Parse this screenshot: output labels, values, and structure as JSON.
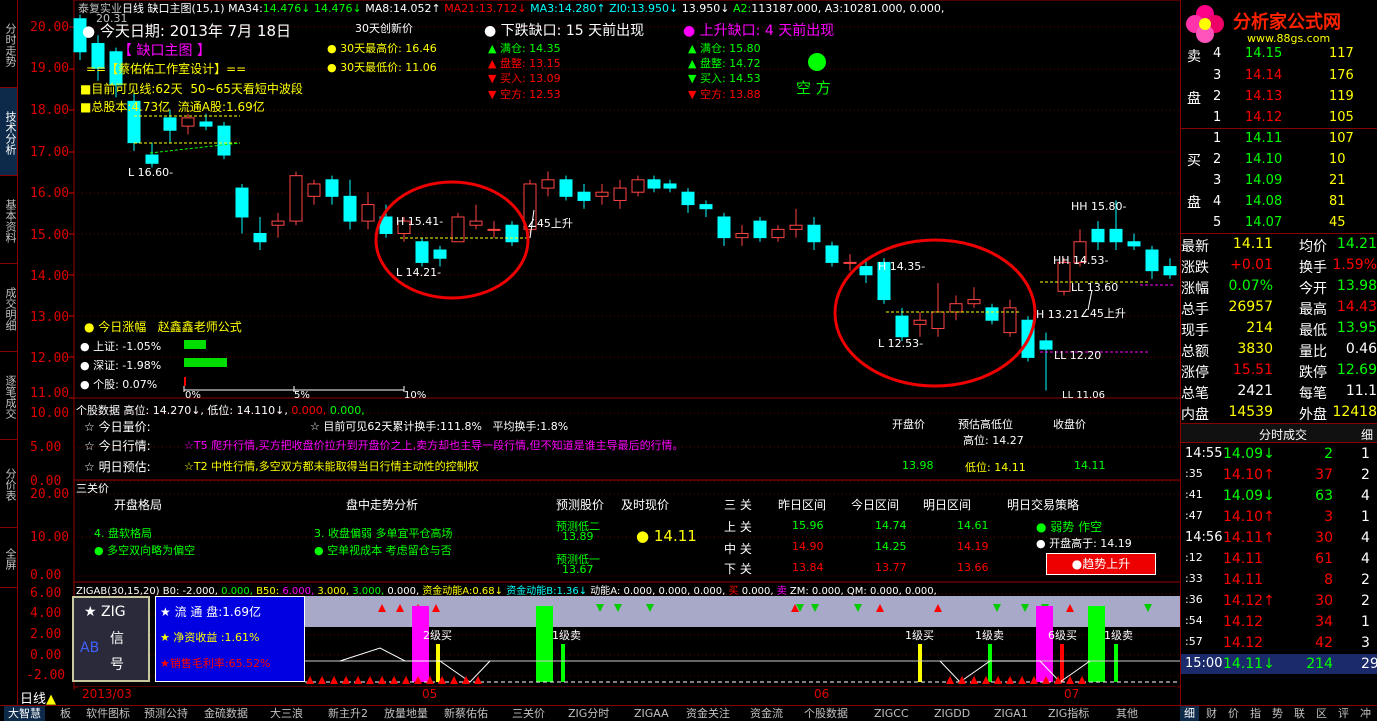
{
  "header": {
    "stock": "泰复实业",
    "period": "日线",
    "title": "缺口主图",
    "params": "(15,1)",
    "ma34_lbl": "MA34:",
    "ma34": "14.476↓",
    "ma34b": "14.476↓",
    "ma8_lbl": "MA8:",
    "ma8": "14.052↑",
    "ma21_lbl": "MA21:",
    "ma21": "13.712↓",
    "ma3_lbl": "MA3:",
    "ma3": "14.280↑",
    "zi0_lbl": "ZI0:",
    "zi0": "13.950↓",
    "zi0b": "13.950↓",
    "a2_lbl": "A2:",
    "a2": "113187.000,",
    "a3_lbl": "A3:",
    "a3": "10281.000,",
    "tail": "0.000,",
    "n1": "0.000",
    "logo_num": "20.31"
  },
  "mainchart": {
    "date_label": "今天日期:",
    "date": "2013年 7月 18日",
    "main_badge": "【 缺口主图 】",
    "designer": "==【蔡佑佑工作室设计】==",
    "visible_line": "目前可见线:62天",
    "wave": "50~65天看短中波段",
    "total_shares": "总股本:4.73亿",
    "float_shares": "流通A股:1.69亿",
    "new30": "30天创新价",
    "hi30": "30天最高价: 16.46",
    "lo30": "30天最低价: 11.06",
    "gap_down": "下跌缺口: 15 天前出现",
    "gap_up": "上升缺口: 4 天前出现",
    "dn_full": "满仓: 14.35",
    "dn_hold": "盘整: 13.15",
    "dn_buy": "买入: 13.09",
    "dn_short": "空方: 12.53",
    "up_full": "满仓: 15.80",
    "up_hold": "盘整: 14.72",
    "up_buy": "买入: 14.53",
    "up_short": "空方: 13.88",
    "side": "空 方",
    "today_rise": "今日涨幅",
    "teacher": "赵鑫鑫老师公式",
    "sh": "上证: -1.05%",
    "sz": "深证: -1.98%",
    "stock_pct": "个股: 0.07%",
    "scale0": "0%",
    "scale5": "5%",
    "scale10": "10%",
    "ann_l1660": "L 16.60-",
    "ann_h1541": "H 15.41-",
    "ann_l1421": "L 14.21-",
    "ann_up45a": "∠45上升",
    "ann_h1435": "H 14.35-",
    "ann_l1253": "L 12.53-",
    "ann_hh1580": "HH 15.80-",
    "ann_hh1453": "HH 14.53-",
    "ann_ll1360": "LL 13.60",
    "ann_h1321": "H 13.21",
    "ann_up45b": "∠45上升",
    "ann_ll1220": "LL 12.20",
    "ann_ll1106": "LL 11.06"
  },
  "yaxis": [
    "20.00",
    "19.00",
    "18.00",
    "17.00",
    "16.00",
    "15.00",
    "14.00",
    "13.00",
    "12.00",
    "11.00"
  ],
  "panel2": {
    "yaxis": [
      "10.00",
      "5.00",
      "0.00"
    ],
    "title": "个股数据",
    "hi": "高位: 14.270↓,",
    "lo": "低位: 14.110↓,",
    "z1": "0.000,",
    "z2": "0.000,",
    "today_qty": "今日量价:",
    "visible_turn": "目前可见62天累计换手:111.8%",
    "avg_turn": "平均换手:1.8%",
    "open_price": "开盘价",
    "est": "预估高低位",
    "close_price": "收盘价",
    "today_state": "今日行情:",
    "t5": "☆T5 爬升行情,买方把收盘价拉升到开盘价之上,卖方却也主导一段行情,但不知道是谁主导最后的行情。",
    "hi_pos": "高位: 14.27",
    "tomorrow": "明日预估:",
    "t2": "☆T2 中性行情,多空双方都未能取得当日行情主动性的控制权",
    "open_val": "13.98",
    "lo_pos": "低位: 14.11",
    "close_val": "14.11"
  },
  "panel3": {
    "yaxis": [
      "20.00",
      "10.00",
      "0.00"
    ],
    "title": "三关价",
    "open_pattern": "开盘格局",
    "intraday": "盘中走势分析",
    "pred": "预测股价",
    "now": "及时现价",
    "three": "三 关",
    "yday": "昨日区间",
    "today_r": "今日区间",
    "tomorrow_r": "明日区间",
    "strategy": "明日交易策略",
    "soft": "4. 盘软格局",
    "bias": "多空双向略为偏空",
    "close_weak": "3. 收盘偏弱 多单宜平仓高场",
    "short_see": "空单视成本 考虑留仓与否",
    "pred2": "预测低二",
    "pred2v": "13.89",
    "pred1": "预测低一",
    "pred1v": "13.67",
    "now_v": "14.11",
    "up": "上 关",
    "mid": "中 关",
    "down": "下 关",
    "up_y": "15.96",
    "up_t": "14.74",
    "up_n": "14.61",
    "mid_y": "14.90",
    "mid_t": "14.25",
    "mid_n": "14.19",
    "dn_y": "13.84",
    "dn_t": "13.77",
    "dn_n": "13.66",
    "weak": "弱势 作空",
    "open_hi": "开盘高于: 14.19",
    "trend": "●趋势上升"
  },
  "panel4": {
    "yaxis": [
      "6.00",
      "4.00",
      "2.00",
      "0.00",
      "-2.00"
    ],
    "header": "ZIGAB(30,15,20)",
    "b0": "B0: -2.000,",
    "h0": "0.000,",
    "b50": "B50:",
    "b50v": "6.000,",
    "h2": "3.000,",
    "h3": "3.000,",
    "h4": "0.000,",
    "zj": "资金动能A:",
    "zjv": "0.68↓",
    "zjb": "资金动能B:",
    "zjbv": "1.36↓",
    "dn": "动能A: 0.000,",
    "t1": "0.000,",
    "t2": "0.000,",
    "buy": "买",
    "sell": "卖",
    "t3": "0.000,",
    "zm": "ZM: 0.000,",
    "qm": "QM: 0.000,",
    "t4": "0.000,",
    "zig_title": "★ ZIG",
    "zig_sig": "信",
    "zig_num": "号",
    "ab": "AB",
    "float": "★ 流 通 盘:1.69亿",
    "net": "★ 净资收益 :1.61%",
    "margin": "★销售毛利率:65.52%",
    "buy2": "2级买",
    "sell1a": "1级卖",
    "buy1": "1级买",
    "sell1b": "1级卖",
    "buy6": "6级买",
    "sell1c": "1级卖",
    "date03": "2013/03",
    "date05": "05",
    "date06": "06",
    "date07": "07"
  },
  "lefttabs": [
    "分时走势",
    "技术分析",
    "基本资料",
    "成交明细",
    "逐笔成交",
    "分价表",
    "全屏"
  ],
  "orderbook": {
    "ask_label": "卖",
    "ask_label2": "盘",
    "bid_label": "买",
    "bid_label2": "盘",
    "asks": [
      {
        "n": "3",
        "p": "14.14",
        "v": "176"
      },
      {
        "n": "2",
        "p": "14.13",
        "v": "119"
      },
      {
        "n": "1",
        "p": "14.12",
        "v": "105"
      }
    ],
    "ask_top": {
      "n": "4",
      "p": "14.15",
      "v": "117"
    },
    "bids": [
      {
        "n": "1",
        "p": "14.11",
        "v": "107"
      },
      {
        "n": "2",
        "p": "14.10",
        "v": "10"
      },
      {
        "n": "3",
        "p": "14.09",
        "v": "21"
      },
      {
        "n": "4",
        "p": "14.08",
        "v": "81"
      },
      {
        "n": "5",
        "p": "14.07",
        "v": "45"
      }
    ]
  },
  "stats": [
    {
      "l": "最新",
      "v": "14.11",
      "l2": "均价",
      "v2": "14.21"
    },
    {
      "l": "涨跌",
      "v": "+0.01",
      "l2": "换手",
      "v2": "1.59%"
    },
    {
      "l": "涨幅",
      "v": "0.07%",
      "l2": "今开",
      "v2": "13.98"
    },
    {
      "l": "总手",
      "v": "26957",
      "l2": "最高",
      "v2": "14.43"
    },
    {
      "l": "现手",
      "v": "214",
      "l2": "最低",
      "v2": "13.95"
    },
    {
      "l": "总额",
      "v": "3830",
      "l2": "量比",
      "v2": "0.46"
    },
    {
      "l": "涨停",
      "v": "15.51",
      "l2": "跌停",
      "v2": "12.69"
    },
    {
      "l": "总笔",
      "v": "2421",
      "l2": "每笔",
      "v2": "11.1"
    },
    {
      "l": "内盘",
      "v": "14539",
      "l2": "外盘",
      "v2": "12418"
    }
  ],
  "ticks_title": "分时成交",
  "ticks_tab": "细",
  "ticks": [
    {
      "t": "14:55",
      "p": "14.09↓",
      "v": "2",
      "n": "1"
    },
    {
      "t": ":35",
      "p": "14.10↑",
      "v": "37",
      "n": "2"
    },
    {
      "t": ":41",
      "p": "14.09↓",
      "v": "63",
      "n": "4"
    },
    {
      "t": ":47",
      "p": "14.10↑",
      "v": "3",
      "n": "1"
    },
    {
      "t": "14:56",
      "p": "14.11↑",
      "v": "30",
      "n": "4"
    },
    {
      "t": ":12",
      "p": "14.11",
      "v": "61",
      "n": "4"
    },
    {
      "t": ":33",
      "p": "14.11",
      "v": "8",
      "n": "2"
    },
    {
      "t": ":36",
      "p": "14.12↑",
      "v": "30",
      "n": "2"
    },
    {
      "t": ":54",
      "p": "14.12",
      "v": "34",
      "n": "1"
    },
    {
      "t": ":57",
      "p": "14.12",
      "v": "42",
      "n": "3"
    },
    {
      "t": "15:00",
      "p": "14.11↓",
      "v": "214",
      "n": "29"
    }
  ],
  "bottom": {
    "period": "日线",
    "items": [
      "大智慧",
      "板",
      "软件图标",
      "预测公持",
      "金硫数据",
      "大三浪",
      "新主升2",
      "放量地量",
      "新蔡佑佑",
      "三关价",
      "ZIG分时",
      "ZIGAA",
      "资金关注",
      "资金流",
      "个股数据",
      "ZIGCC",
      "ZIGDD",
      "ZIGA1",
      "ZIG指标",
      "其他"
    ],
    "rtabs": [
      "细",
      "财",
      "价",
      "指",
      "势",
      "联",
      "区",
      "评",
      "冲"
    ]
  },
  "site": {
    "name": "分析家公式网",
    "url": "www.88gs.com"
  }
}
